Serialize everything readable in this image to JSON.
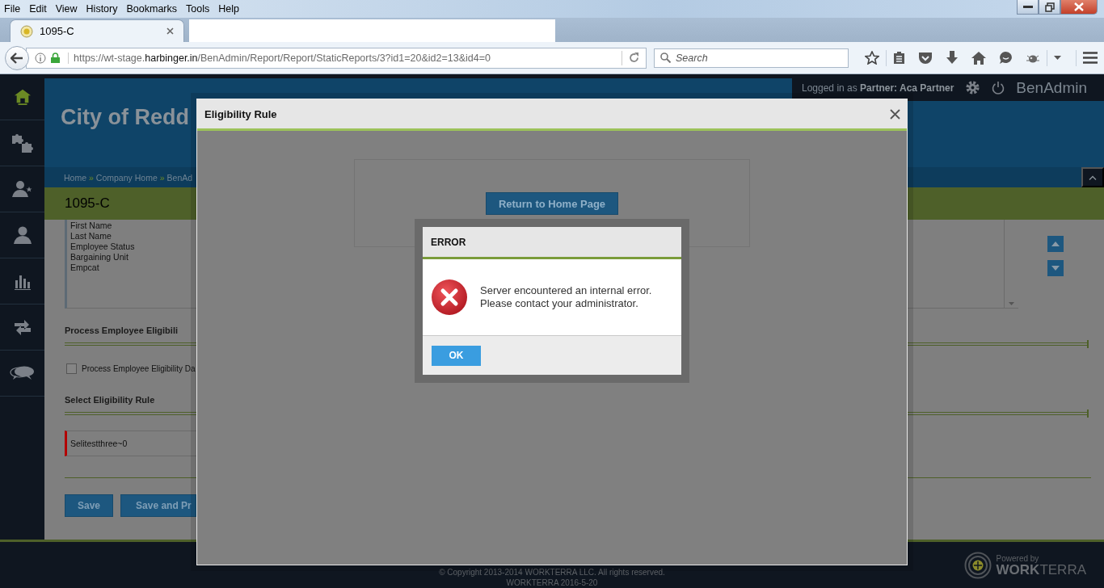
{
  "browser": {
    "menu": [
      "File",
      "Edit",
      "View",
      "History",
      "Bookmarks",
      "Tools",
      "Help"
    ],
    "tabs": [
      {
        "label": "1095-C",
        "selected": true
      }
    ],
    "url": "https://wt-stage.**harbinger.in**/BenAdmin/Report/Report/StaticReports/3?id1=20&id2=13&id4=0",
    "search": {
      "placeholder": "Search"
    }
  },
  "sidebar": {
    "items": [
      {
        "kind": "home",
        "selected": true
      },
      {
        "kind": "puzzle",
        "selected": false
      },
      {
        "kind": "user-star",
        "selected": false
      },
      {
        "kind": "user",
        "selected": false
      },
      {
        "kind": "chart",
        "selected": false
      },
      {
        "kind": "transfer",
        "selected": false
      },
      {
        "kind": "chat",
        "selected": false
      }
    ]
  },
  "topbar": {
    "login": "Logged in as **Partner:  Aca Partner**",
    "brand": "BenAdmin"
  },
  "header": {
    "title": "City of Redd"
  },
  "breadcrumb": {
    "items": [
      "Home",
      "Company Home",
      "BenAd"
    ],
    "separator": "»"
  },
  "page_title": "1095-C",
  "fields_list": [
    "First Name",
    "Last Name",
    "Employee Status",
    "Bargaining Unit",
    "Empcat"
  ],
  "process_section": {
    "heading": "Process Employee Eligibili",
    "checkbox": {
      "label": "Process Employee Eligibility Da",
      "checked": false
    }
  },
  "rule_section": {
    "heading": "Select Eligibility Rule",
    "select": {
      "value": "Selitestthree~0"
    }
  },
  "buttons": [
    "Save",
    "Save and Pr"
  ],
  "footer": {
    "copyright": "© Copyright 2013-2014 WORKTERRA LLC. All rights reserved.",
    "version": "WORKTERRA 2016-5-20",
    "powered_by": "Powered by",
    "brand": "**WORK**TERRA"
  },
  "modal": {
    "title": "Eligibility Rule",
    "button": "Return to Home Page"
  },
  "error_dialog": {
    "title": "ERROR",
    "message": "Server encountered an internal error. Please contact your administrator.",
    "button": "OK"
  }
}
